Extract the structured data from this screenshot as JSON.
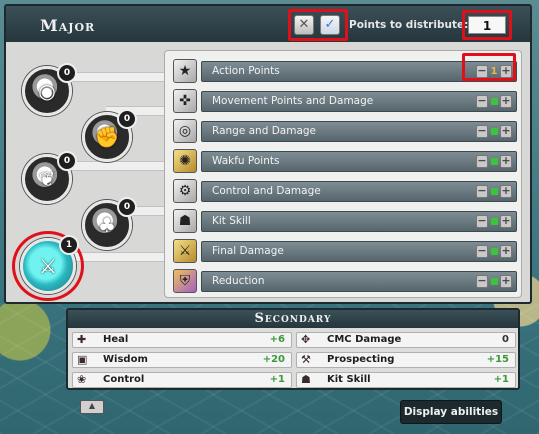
{
  "window": {
    "title": "Major",
    "points_label": "Points to distribute:",
    "points_value": "1",
    "close_glyph": "✕",
    "cancel_glyph": "✕",
    "confirm_glyph": "✓"
  },
  "tree_nodes": [
    {
      "badge": "0",
      "icon": "mask-icon"
    },
    {
      "badge": "0",
      "icon": "fist-icon"
    },
    {
      "badge": "0",
      "icon": "wing-icon"
    },
    {
      "badge": "0",
      "icon": "clover-icon"
    },
    {
      "badge": "1",
      "icon": "crossed-swords-icon"
    }
  ],
  "major_rows": [
    {
      "label": "Action Points",
      "value": "1",
      "icon": "star-icon"
    },
    {
      "label": "Movement Points and Damage",
      "value": "0",
      "icon": "boot-icon"
    },
    {
      "label": "Range and Damage",
      "value": "0",
      "icon": "target-icon"
    },
    {
      "label": "Wakfu Points",
      "value": "0",
      "icon": "wakfu-icon"
    },
    {
      "label": "Control and Damage",
      "value": "0",
      "icon": "control-icon"
    },
    {
      "label": "Kit Skill",
      "value": "0",
      "icon": "kit-icon"
    },
    {
      "label": "Final Damage",
      "value": "0",
      "icon": "swords-icon"
    },
    {
      "label": "Reduction",
      "value": "0",
      "icon": "shield-icon"
    }
  ],
  "secondary": {
    "title": "Secondary",
    "stats": [
      {
        "name": "Heal",
        "value": "+6",
        "icon": "heal-icon"
      },
      {
        "name": "CMC Damage",
        "value": "0",
        "icon": "cmc-icon"
      },
      {
        "name": "Wisdom",
        "value": "+20",
        "icon": "book-icon"
      },
      {
        "name": "Prospecting",
        "value": "+15",
        "icon": "prospecting-icon"
      },
      {
        "name": "Control",
        "value": "+1",
        "icon": "paw-icon"
      },
      {
        "name": "Kit Skill",
        "value": "+1",
        "icon": "kit-icon"
      }
    ]
  },
  "footer": {
    "display_abilities": "Display abilities"
  },
  "colors": {
    "highlight": "#e0101a",
    "titlebar": "#2f4249",
    "positive_value": "#3a9a3a",
    "active_node": "#2bb8c0"
  }
}
